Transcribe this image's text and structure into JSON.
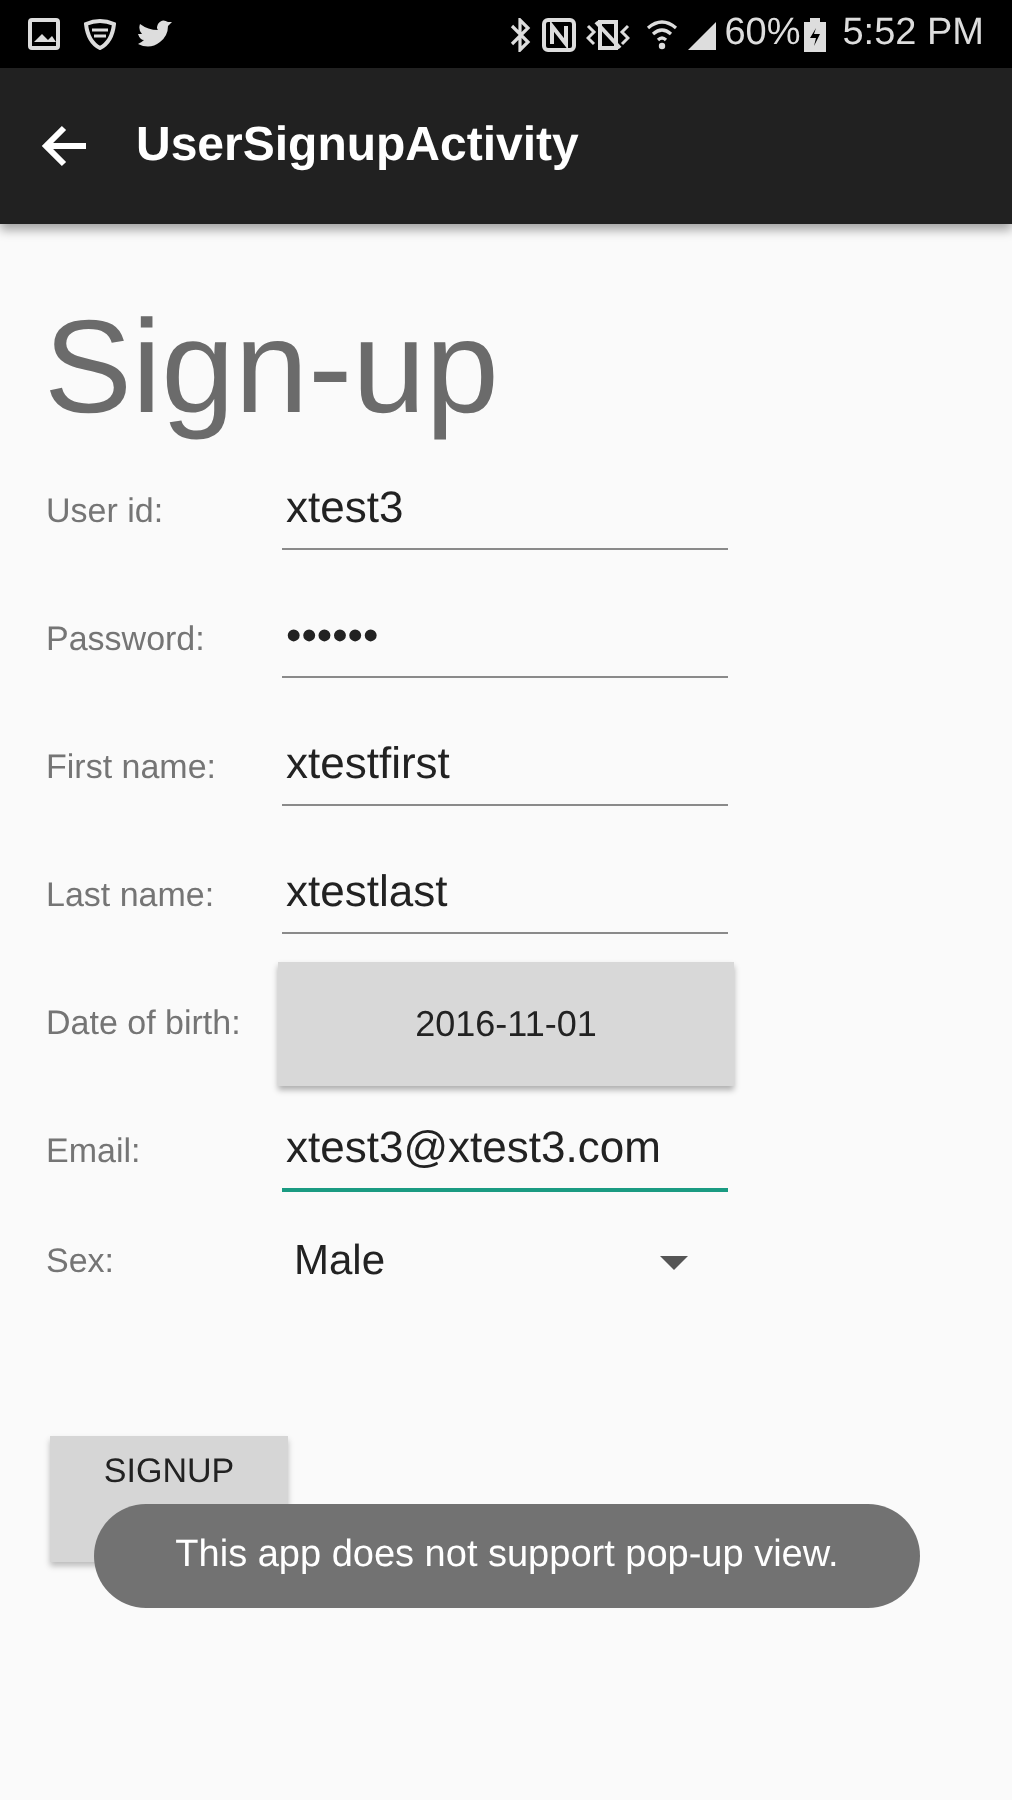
{
  "status_bar": {
    "battery": "60%",
    "time": "5:52 PM"
  },
  "toolbar": {
    "title": "UserSignupActivity"
  },
  "heading": "Sign-up",
  "fields": [
    {
      "kind": "text",
      "label": "User id:",
      "value": "xtest3",
      "focused": false
    },
    {
      "kind": "text",
      "label": "Password:",
      "value": "••••••",
      "focused": false
    },
    {
      "kind": "text",
      "label": "First name:",
      "value": "xtestfirst",
      "focused": false
    },
    {
      "kind": "text",
      "label": "Last name:",
      "value": "xtestlast",
      "focused": false
    },
    {
      "kind": "date",
      "label": "Date of birth:",
      "value": "2016-11-01"
    },
    {
      "kind": "text",
      "label": "Email:",
      "value": "xtest3@xtest3.com",
      "focused": true
    },
    {
      "kind": "spinner",
      "label": "Sex:",
      "value": "Male"
    }
  ],
  "submit_button": "SIGNUP",
  "toast": "This app does not support pop-up view."
}
